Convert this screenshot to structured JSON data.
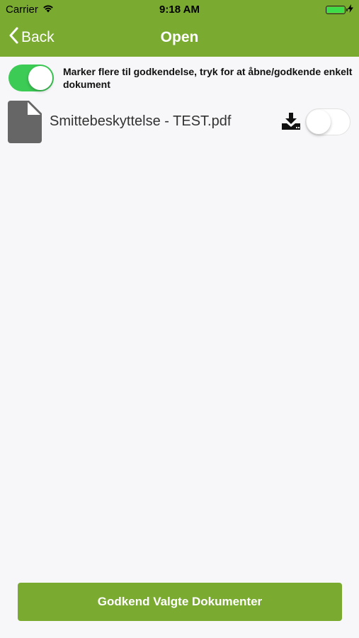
{
  "status_bar": {
    "carrier": "Carrier",
    "time": "9:18 AM"
  },
  "nav": {
    "back_label": "Back",
    "title": "Open"
  },
  "multi_select": {
    "enabled": true,
    "label": "Marker flere til godkendelse, tryk for at åbne/godkende enkelt dokument"
  },
  "documents": [
    {
      "name": "Smittebeskyttelse - TEST.pdf",
      "selected": false,
      "icon": "file-icon"
    }
  ],
  "approve_button": {
    "label": "Godkend Valgte Dokumenter"
  },
  "colors": {
    "brand_green": "#7aab30",
    "toggle_on": "#3ccb55",
    "background": "#f7f7f9"
  }
}
